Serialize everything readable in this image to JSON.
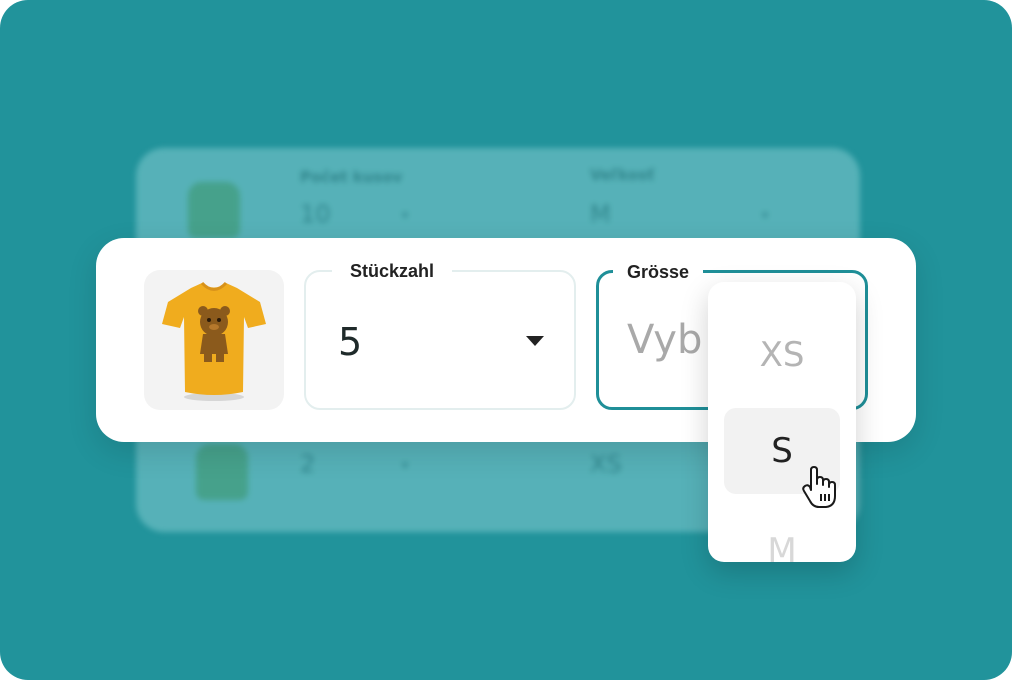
{
  "background": {
    "row1": {
      "qty_label": "Počet kusov",
      "qty_value": "10",
      "size_label": "Veľkosť",
      "size_value": "M"
    },
    "row2": {
      "qty_value": "2",
      "size_value": "XS"
    },
    "caret": "▾"
  },
  "product": {
    "icon": "tshirt-image",
    "color": "#f0ac1e"
  },
  "quantity": {
    "label": "Stückzahl",
    "value": "5"
  },
  "size": {
    "label": "Grösse",
    "placeholder": "Vyb"
  },
  "dropdown": {
    "options": [
      "XS",
      "S",
      "M"
    ],
    "highlighted": "S"
  },
  "colors": {
    "background": "#21939b",
    "accent": "#1f8f98"
  }
}
